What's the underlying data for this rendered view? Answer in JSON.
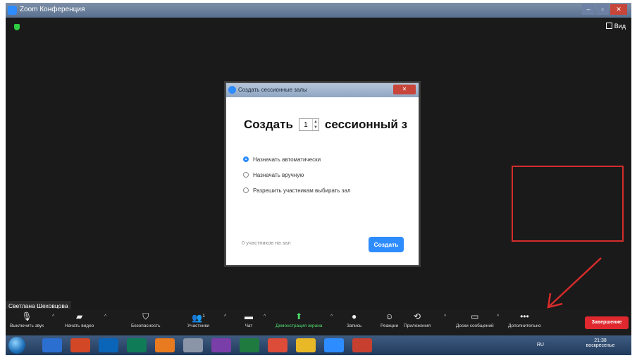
{
  "window": {
    "title": "Zoom Конференция",
    "minimize": "–",
    "maximize": "▫",
    "close": "✕"
  },
  "top_right": {
    "view_label": "Вид"
  },
  "dialog": {
    "title": "Создать сессионные залы",
    "heading_prefix": "Создать",
    "room_count": "1",
    "heading_suffix": "сессионный з",
    "options": [
      {
        "label": "Назначать автоматически",
        "selected": true
      },
      {
        "label": "Назначать вручную",
        "selected": false
      },
      {
        "label": "Разрешить участникам выбирать зал",
        "selected": false
      }
    ],
    "footer_text": "0 участников на зал",
    "create_button": "Создать"
  },
  "participant_name": "Светлана Шеховцова",
  "toolbar": {
    "mute": "Выключить звук",
    "video": "Начать видео",
    "security": "Безопасность",
    "participants": "Участники",
    "participants_count": "1",
    "chat": "Чат",
    "share": "Демонстрация экрана",
    "record": "Запись",
    "reactions": "Реакции",
    "apps": "Приложения",
    "whiteboard": "Доски сообщений",
    "more": "Дополнительно",
    "end": "Завершение"
  },
  "taskbar": {
    "lang": "RU",
    "time": "21:38",
    "day": "воскресенье"
  },
  "colors": {
    "accent": "#2d8cff",
    "annotation": "#d52b2b",
    "end_button": "#e0292e"
  }
}
